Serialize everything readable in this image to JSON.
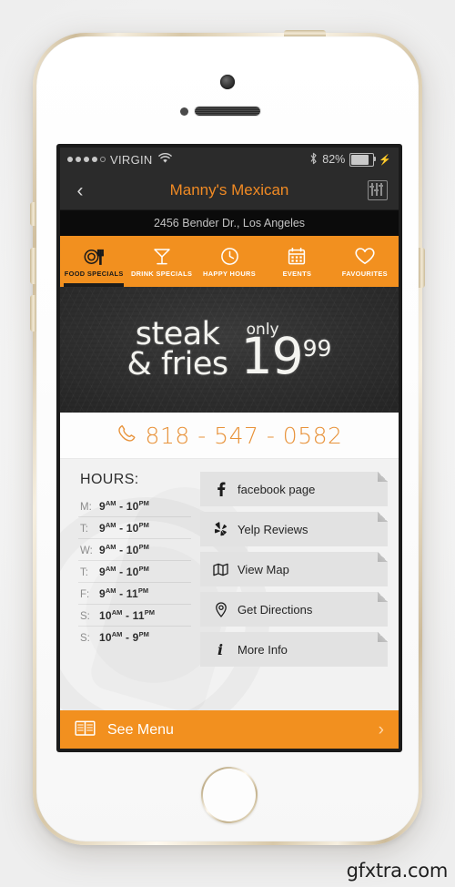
{
  "watermark": "gfxtra.com",
  "status_bar": {
    "carrier": "VIRGIN",
    "signal_dots_total": 5,
    "signal_dots_filled": 4,
    "wifi_icon": "wifi-icon",
    "bluetooth_icon": "bluetooth-icon",
    "battery_percent": "82%",
    "battery_level": 82,
    "charging_icon": "lightning-bolt-icon"
  },
  "nav_bar": {
    "back_icon": "chevron-left-icon",
    "title": "Manny's Mexican",
    "filter_icon": "sliders-icon",
    "title_color": "#f08a24"
  },
  "address_bar": {
    "text": "2456 Bender Dr., Los Angeles"
  },
  "tabs": {
    "accent_color": "#f2901f",
    "items": [
      {
        "label": "FOOD SPECIALS",
        "icon": "plate-and-fork-icon",
        "active": true
      },
      {
        "label": "DRINK SPECIALS",
        "icon": "cocktail-glass-icon",
        "active": false
      },
      {
        "label": "HAPPY HOURS",
        "icon": "clock-icon",
        "active": false
      },
      {
        "label": "EVENTS",
        "icon": "calendar-icon",
        "active": false
      },
      {
        "label": "FAVOURITES",
        "icon": "heart-icon",
        "active": false
      }
    ]
  },
  "promo": {
    "line1": "steak",
    "line2": "& fries",
    "only_label": "only",
    "price_main": "19",
    "price_cents": "99"
  },
  "phone": {
    "icon": "phone-handset-icon",
    "number": "818 - 547 - 0582"
  },
  "hours": {
    "title": "HOURS:",
    "rows": [
      {
        "day": "M:",
        "open": "9",
        "open_suffix": "AM",
        "close": "10",
        "close_suffix": "PM"
      },
      {
        "day": "T:",
        "open": "9",
        "open_suffix": "AM",
        "close": "10",
        "close_suffix": "PM"
      },
      {
        "day": "W:",
        "open": "9",
        "open_suffix": "AM",
        "close": "10",
        "close_suffix": "PM"
      },
      {
        "day": "T:",
        "open": "9",
        "open_suffix": "AM",
        "close": "10",
        "close_suffix": "PM"
      },
      {
        "day": "F:",
        "open": "9",
        "open_suffix": "AM",
        "close": "11",
        "close_suffix": "PM"
      },
      {
        "day": "S:",
        "open": "10",
        "open_suffix": "AM",
        "close": "11",
        "close_suffix": "PM"
      },
      {
        "day": "S:",
        "open": "10",
        "open_suffix": "AM",
        "close": "9",
        "close_suffix": "PM"
      }
    ]
  },
  "actions": [
    {
      "label": "facebook page",
      "icon": "facebook-icon"
    },
    {
      "label": "Yelp Reviews",
      "icon": "yelp-icon"
    },
    {
      "label": "View Map",
      "icon": "map-icon"
    },
    {
      "label": "Get Directions",
      "icon": "location-pin-icon"
    },
    {
      "label": "More Info",
      "icon": "info-icon"
    }
  ],
  "see_menu": {
    "icon": "open-book-icon",
    "label": "See Menu",
    "chevron": "chevron-right-icon"
  }
}
